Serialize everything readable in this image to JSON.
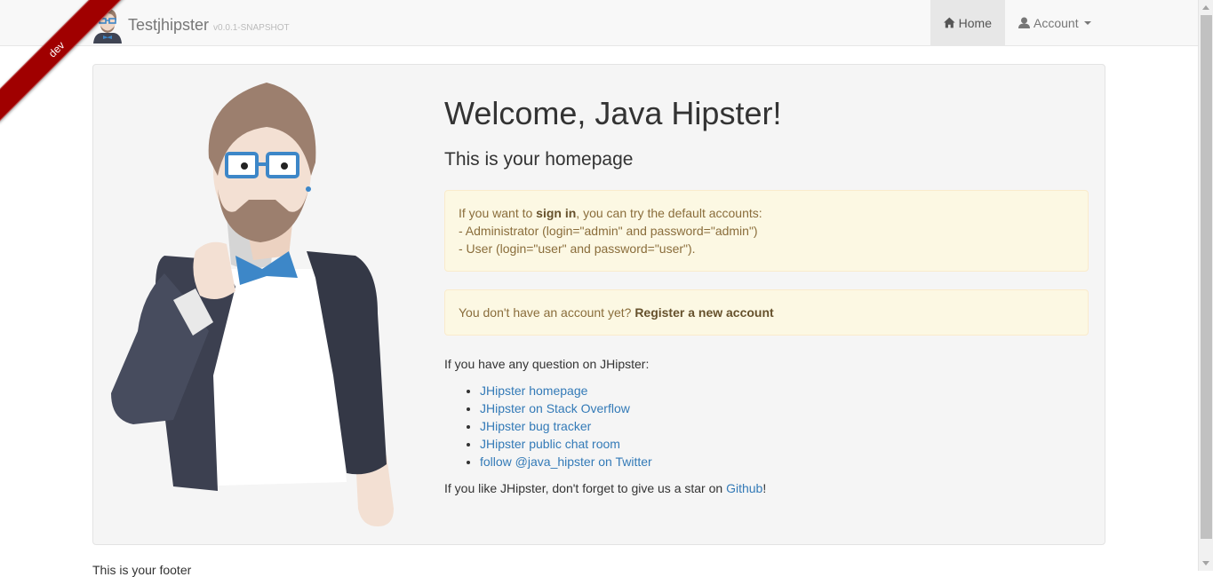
{
  "ribbon": {
    "label": "dev"
  },
  "navbar": {
    "brand_name": "Testjhipster",
    "brand_version": "v0.0.1-SNAPSHOT",
    "home_label": "Home",
    "account_label": "Account"
  },
  "main": {
    "title": "Welcome, Java Hipster!",
    "subtitle": "This is your homepage",
    "signin_alert": {
      "prefix": "If you want to ",
      "signin_link": "sign in",
      "suffix": ", you can try the default accounts:",
      "admin_line": "- Administrator (login=\"admin\" and password=\"admin\")",
      "user_line": "- User (login=\"user\" and password=\"user\")."
    },
    "register_alert": {
      "prefix": "You don't have an account yet? ",
      "register_link": "Register a new account"
    },
    "question": "If you have any question on JHipster:",
    "links": [
      "JHipster homepage",
      "JHipster on Stack Overflow",
      "JHipster bug tracker",
      "JHipster public chat room",
      "follow @java_hipster on Twitter"
    ],
    "star_prefix": "If you like JHipster, don't forget to give us a star on ",
    "github_link": "Github",
    "star_suffix": "!"
  },
  "footer": {
    "text": "This is your footer"
  },
  "colors": {
    "navbar_bg": "#f8f8f8",
    "ribbon": "#a00000",
    "link": "#337ab7",
    "alert_bg": "#fcf8e3",
    "alert_text": "#8a6d3b"
  }
}
